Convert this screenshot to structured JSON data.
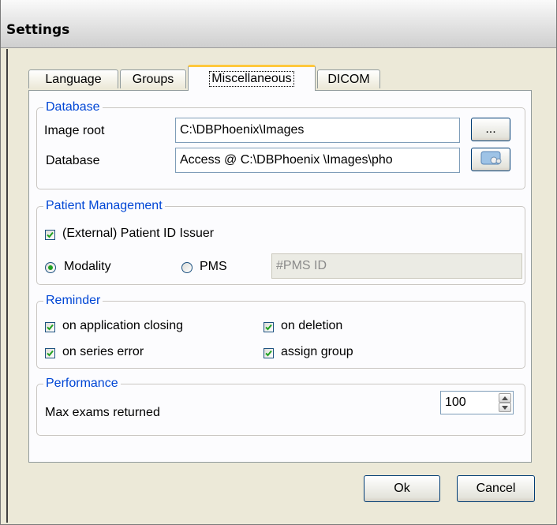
{
  "window": {
    "title": "Settings"
  },
  "tabs": [
    {
      "label": "Language",
      "active": false
    },
    {
      "label": "Groups",
      "active": false
    },
    {
      "label": "Miscellaneous",
      "active": true
    },
    {
      "label": "DICOM",
      "active": false
    }
  ],
  "database": {
    "legend": "Database",
    "image_root_label": "Image root",
    "image_root_value": "C:\\DBPhoenix\\Images",
    "browse_label": "...",
    "database_label": "Database",
    "database_value": "Access @ C:\\DBPhoenix \\Images\\pho",
    "config_icon": "database-config-icon"
  },
  "patient": {
    "legend": "Patient Management",
    "external_id_label": "(External) Patient ID Issuer",
    "external_id_checked": true,
    "modality_label": "Modality",
    "modality_selected": true,
    "pms_label": "PMS",
    "pms_selected": false,
    "pms_id_placeholder": "#PMS ID"
  },
  "reminder": {
    "legend": "Reminder",
    "on_app_closing": "on application closing",
    "on_deletion": "on deletion",
    "on_series_error": "on series error",
    "assign_group": "assign group"
  },
  "performance": {
    "legend": "Performance",
    "max_exams_label": "Max exams returned",
    "max_exams_value": "100"
  },
  "buttons": {
    "ok": "Ok",
    "cancel": "Cancel"
  },
  "colors": {
    "legend": "#0046d5",
    "check": "#21a121",
    "active_tab_accent": "#ffc83c"
  }
}
